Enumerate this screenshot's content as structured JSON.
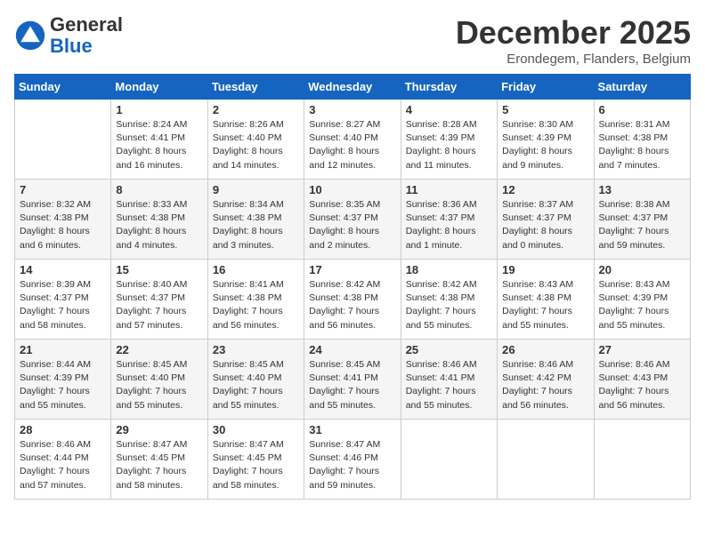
{
  "logo": {
    "general": "General",
    "blue": "Blue"
  },
  "title": "December 2025",
  "subtitle": "Erondegem, Flanders, Belgium",
  "days_of_week": [
    "Sunday",
    "Monday",
    "Tuesday",
    "Wednesday",
    "Thursday",
    "Friday",
    "Saturday"
  ],
  "weeks": [
    [
      {
        "day": "",
        "info": ""
      },
      {
        "day": "1",
        "info": "Sunrise: 8:24 AM\nSunset: 4:41 PM\nDaylight: 8 hours\nand 16 minutes."
      },
      {
        "day": "2",
        "info": "Sunrise: 8:26 AM\nSunset: 4:40 PM\nDaylight: 8 hours\nand 14 minutes."
      },
      {
        "day": "3",
        "info": "Sunrise: 8:27 AM\nSunset: 4:40 PM\nDaylight: 8 hours\nand 12 minutes."
      },
      {
        "day": "4",
        "info": "Sunrise: 8:28 AM\nSunset: 4:39 PM\nDaylight: 8 hours\nand 11 minutes."
      },
      {
        "day": "5",
        "info": "Sunrise: 8:30 AM\nSunset: 4:39 PM\nDaylight: 8 hours\nand 9 minutes."
      },
      {
        "day": "6",
        "info": "Sunrise: 8:31 AM\nSunset: 4:38 PM\nDaylight: 8 hours\nand 7 minutes."
      }
    ],
    [
      {
        "day": "7",
        "info": "Sunrise: 8:32 AM\nSunset: 4:38 PM\nDaylight: 8 hours\nand 6 minutes."
      },
      {
        "day": "8",
        "info": "Sunrise: 8:33 AM\nSunset: 4:38 PM\nDaylight: 8 hours\nand 4 minutes."
      },
      {
        "day": "9",
        "info": "Sunrise: 8:34 AM\nSunset: 4:38 PM\nDaylight: 8 hours\nand 3 minutes."
      },
      {
        "day": "10",
        "info": "Sunrise: 8:35 AM\nSunset: 4:37 PM\nDaylight: 8 hours\nand 2 minutes."
      },
      {
        "day": "11",
        "info": "Sunrise: 8:36 AM\nSunset: 4:37 PM\nDaylight: 8 hours\nand 1 minute."
      },
      {
        "day": "12",
        "info": "Sunrise: 8:37 AM\nSunset: 4:37 PM\nDaylight: 8 hours\nand 0 minutes."
      },
      {
        "day": "13",
        "info": "Sunrise: 8:38 AM\nSunset: 4:37 PM\nDaylight: 7 hours\nand 59 minutes."
      }
    ],
    [
      {
        "day": "14",
        "info": "Sunrise: 8:39 AM\nSunset: 4:37 PM\nDaylight: 7 hours\nand 58 minutes."
      },
      {
        "day": "15",
        "info": "Sunrise: 8:40 AM\nSunset: 4:37 PM\nDaylight: 7 hours\nand 57 minutes."
      },
      {
        "day": "16",
        "info": "Sunrise: 8:41 AM\nSunset: 4:38 PM\nDaylight: 7 hours\nand 56 minutes."
      },
      {
        "day": "17",
        "info": "Sunrise: 8:42 AM\nSunset: 4:38 PM\nDaylight: 7 hours\nand 56 minutes."
      },
      {
        "day": "18",
        "info": "Sunrise: 8:42 AM\nSunset: 4:38 PM\nDaylight: 7 hours\nand 55 minutes."
      },
      {
        "day": "19",
        "info": "Sunrise: 8:43 AM\nSunset: 4:38 PM\nDaylight: 7 hours\nand 55 minutes."
      },
      {
        "day": "20",
        "info": "Sunrise: 8:43 AM\nSunset: 4:39 PM\nDaylight: 7 hours\nand 55 minutes."
      }
    ],
    [
      {
        "day": "21",
        "info": "Sunrise: 8:44 AM\nSunset: 4:39 PM\nDaylight: 7 hours\nand 55 minutes."
      },
      {
        "day": "22",
        "info": "Sunrise: 8:45 AM\nSunset: 4:40 PM\nDaylight: 7 hours\nand 55 minutes."
      },
      {
        "day": "23",
        "info": "Sunrise: 8:45 AM\nSunset: 4:40 PM\nDaylight: 7 hours\nand 55 minutes."
      },
      {
        "day": "24",
        "info": "Sunrise: 8:45 AM\nSunset: 4:41 PM\nDaylight: 7 hours\nand 55 minutes."
      },
      {
        "day": "25",
        "info": "Sunrise: 8:46 AM\nSunset: 4:41 PM\nDaylight: 7 hours\nand 55 minutes."
      },
      {
        "day": "26",
        "info": "Sunrise: 8:46 AM\nSunset: 4:42 PM\nDaylight: 7 hours\nand 56 minutes."
      },
      {
        "day": "27",
        "info": "Sunrise: 8:46 AM\nSunset: 4:43 PM\nDaylight: 7 hours\nand 56 minutes."
      }
    ],
    [
      {
        "day": "28",
        "info": "Sunrise: 8:46 AM\nSunset: 4:44 PM\nDaylight: 7 hours\nand 57 minutes."
      },
      {
        "day": "29",
        "info": "Sunrise: 8:47 AM\nSunset: 4:45 PM\nDaylight: 7 hours\nand 58 minutes."
      },
      {
        "day": "30",
        "info": "Sunrise: 8:47 AM\nSunset: 4:45 PM\nDaylight: 7 hours\nand 58 minutes."
      },
      {
        "day": "31",
        "info": "Sunrise: 8:47 AM\nSunset: 4:46 PM\nDaylight: 7 hours\nand 59 minutes."
      },
      {
        "day": "",
        "info": ""
      },
      {
        "day": "",
        "info": ""
      },
      {
        "day": "",
        "info": ""
      }
    ]
  ]
}
